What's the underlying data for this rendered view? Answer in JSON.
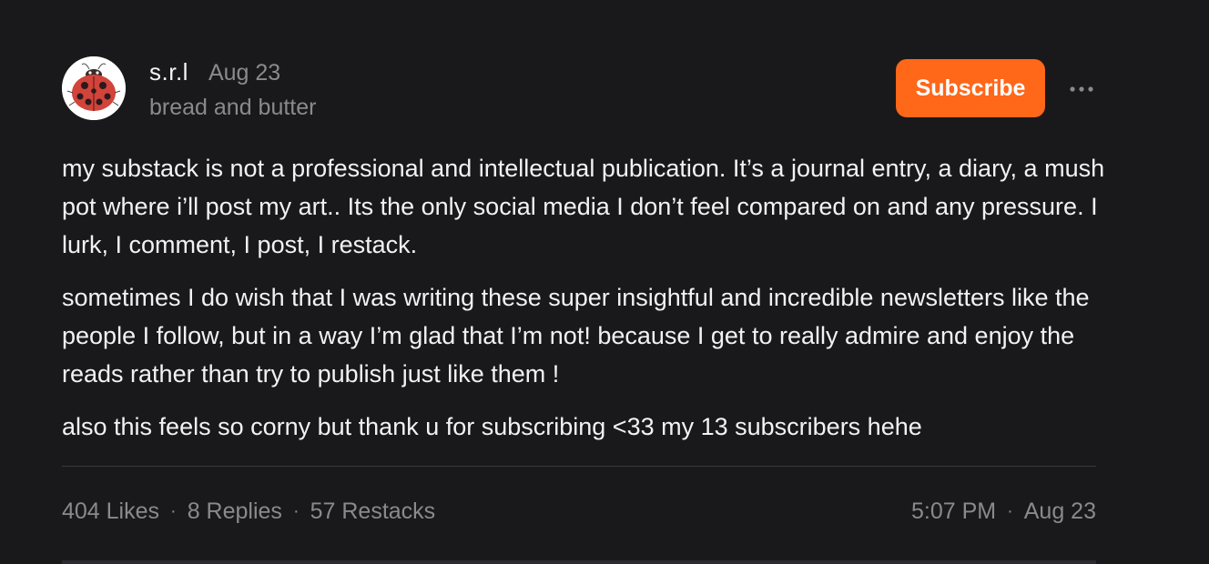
{
  "post": {
    "author": "s.r.l",
    "date": "Aug 23",
    "byline": "bread and butter",
    "subscribe_label": "Subscribe",
    "paragraphs": [
      "my substack is not a professional and intellectual publication. It’s a journal entry, a diary, a mush pot where i’ll post my art.. Its the only social media I don’t feel compared on and any pressure. I lurk, I comment, I post, I restack.",
      "sometimes I do wish that I was writing these super insightful and incredible newsletters like the people I follow, but in a way I’m glad that I’m not! because I get to really admire and enjoy the reads rather than try to publish just like them !",
      "also this feels so corny but thank u for subscribing <33 my 13 subscribers hehe"
    ],
    "likes": "404 Likes",
    "replies": "8 Replies",
    "restacks": "57 Restacks",
    "time": "5:07 PM",
    "footer_date": "Aug 23",
    "separator": "·"
  },
  "icons": {
    "avatar": "ladybug-avatar-icon",
    "more": "more-options-icon"
  },
  "colors": {
    "background": "#19191b",
    "accent": "#ff6719",
    "muted": "#8a8a8e",
    "text": "#f2f2f2"
  }
}
